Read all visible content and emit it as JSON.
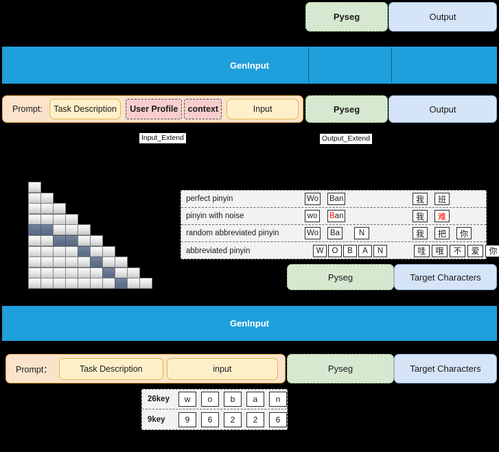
{
  "top_row": {
    "pyseg": "Pyseg",
    "output": "Output"
  },
  "geninput_top": {
    "label": "GenInput"
  },
  "prompt_row_top": {
    "prompt_label": "Prompt:",
    "task_description": "Task Description",
    "user_profile": "User Profile",
    "context": "context",
    "input": "Input",
    "pyseg": "Pyseg",
    "output": "Output"
  },
  "annotations": {
    "input_extend": "Input_Extend",
    "output_extend": "Output_Extend"
  },
  "staircase": {
    "rows": [
      {
        "cells": 1,
        "highlight": []
      },
      {
        "cells": 2,
        "highlight": []
      },
      {
        "cells": 3,
        "highlight": []
      },
      {
        "cells": 4,
        "highlight": []
      },
      {
        "cells": 5,
        "highlight": [
          0,
          1
        ]
      },
      {
        "cells": 6,
        "highlight": [
          2,
          3
        ]
      },
      {
        "cells": 7,
        "highlight": [
          4
        ]
      },
      {
        "cells": 8,
        "highlight": [
          5
        ]
      },
      {
        "cells": 9,
        "highlight": [
          6
        ]
      },
      {
        "cells": 10,
        "highlight": [
          7
        ]
      }
    ]
  },
  "pinyin_table": {
    "rows": [
      {
        "label": "perfect pinyin",
        "pinyin": [
          {
            "text": "Wo"
          },
          {
            "text": "Ban"
          }
        ],
        "chars": [
          {
            "text": "我"
          },
          {
            "text": "班"
          }
        ]
      },
      {
        "label": "pinyin with noise",
        "pinyin": [
          {
            "text": "wo"
          },
          {
            "text": "Ban",
            "red_prefix": "B",
            "rest": "an"
          }
        ],
        "chars": [
          {
            "text": "我"
          },
          {
            "text": "难",
            "red": true
          }
        ]
      },
      {
        "label": "random abbreviated pinyin",
        "pinyin": [
          {
            "text": "Wo"
          },
          {
            "text": "Ba"
          },
          {
            "text": "N"
          }
        ],
        "chars": [
          {
            "text": "我"
          },
          {
            "text": "把"
          },
          {
            "text": "你"
          }
        ]
      },
      {
        "label": "abbreviated pinyin",
        "pinyin": [
          {
            "text": "W"
          },
          {
            "text": "O"
          },
          {
            "text": "B"
          },
          {
            "text": "A"
          },
          {
            "text": "N"
          }
        ],
        "chars": [
          {
            "text": "哇"
          },
          {
            "text": "哦"
          },
          {
            "text": "不"
          },
          {
            "text": "爱"
          },
          {
            "text": "你"
          }
        ]
      }
    ]
  },
  "mid_row": {
    "pyseg": "Pyseg",
    "target_characters": "Target Characters"
  },
  "geninput_bottom": {
    "label": "GenInput"
  },
  "prompt_row_bottom": {
    "prompt_label": "Prompt：",
    "task_description": "Task Description",
    "input": "input",
    "pyseg": "Pyseg",
    "target_characters": "Target Characters"
  },
  "key_table": {
    "rows": [
      {
        "label": "26key",
        "values": [
          "w",
          "o",
          "b",
          "a",
          "n"
        ]
      },
      {
        "label": "9key",
        "values": [
          "9",
          "6",
          "2",
          "2",
          "6"
        ]
      }
    ]
  },
  "colors": {
    "geninput_blue": "#1f9fdb",
    "pyseg_green": "#d7e8d0",
    "output_blue": "#d6e4f7",
    "prompt_peach": "#fbe3cb",
    "pill_yellow": "#fdf0c9",
    "profile_red": "#f7cdcd",
    "highlight_slate": "#63738c",
    "noise_red": "#ff0000"
  }
}
